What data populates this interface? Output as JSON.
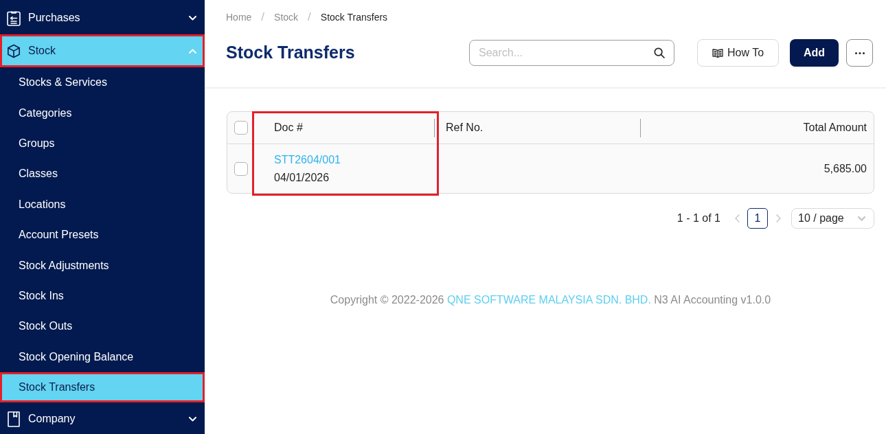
{
  "sidebar": {
    "items": [
      {
        "label": "Purchases",
        "expanded": false,
        "selected": false,
        "annotated": false
      },
      {
        "label": "Stock",
        "expanded": true,
        "selected": true,
        "annotated": true,
        "children": [
          {
            "label": "Stocks & Services",
            "selected": false,
            "annotated": false
          },
          {
            "label": "Categories",
            "selected": false,
            "annotated": false
          },
          {
            "label": "Groups",
            "selected": false,
            "annotated": false
          },
          {
            "label": "Classes",
            "selected": false,
            "annotated": false
          },
          {
            "label": "Locations",
            "selected": false,
            "annotated": false
          },
          {
            "label": "Account Presets",
            "selected": false,
            "annotated": false
          },
          {
            "label": "Stock Adjustments",
            "selected": false,
            "annotated": false
          },
          {
            "label": "Stock Ins",
            "selected": false,
            "annotated": false
          },
          {
            "label": "Stock Outs",
            "selected": false,
            "annotated": false
          },
          {
            "label": "Stock Opening Balance",
            "selected": false,
            "annotated": false
          },
          {
            "label": "Stock Transfers",
            "selected": true,
            "annotated": true
          }
        ]
      },
      {
        "label": "Company",
        "expanded": false,
        "selected": false,
        "annotated": false
      }
    ]
  },
  "breadcrumb": [
    {
      "kind": "link",
      "text": "Home"
    },
    {
      "kind": "separator",
      "text": "/"
    },
    {
      "kind": "link",
      "text": "Stock"
    },
    {
      "kind": "separator",
      "text": "/"
    },
    {
      "kind": "current",
      "text": "Stock Transfers"
    }
  ],
  "title": "Stock Transfers",
  "search": {
    "placeholder": "Search..."
  },
  "buttons": [
    {
      "kind": "guide",
      "label": "How To"
    },
    {
      "kind": "primary",
      "label": "Add"
    },
    {
      "kind": "more"
    }
  ],
  "table": {
    "select_all_checked": false,
    "columns": [
      {
        "label": "Doc #",
        "annotated": true
      },
      {
        "label": "Ref No.",
        "annotated": false
      },
      {
        "label": "Total Amount",
        "annotated": false
      }
    ],
    "rows": [
      {
        "checked": false,
        "doc_no": "STT2604/001",
        "date": "04/01/2026",
        "total": "5,685.00"
      }
    ]
  },
  "pagination": {
    "summary": "1 - 1 of 1",
    "prev": {
      "disabled": true
    },
    "pages": [
      {
        "label": "1",
        "selected": true
      }
    ],
    "next": {
      "disabled": true
    },
    "page_size": "10 / page"
  },
  "footer": {
    "prefix": "Copyright © 2022-2026",
    "company": "QNE SOFTWARE MALAYSIA SDN. BHD.",
    "suffix": "N3 AI Accounting v1.0.0"
  }
}
